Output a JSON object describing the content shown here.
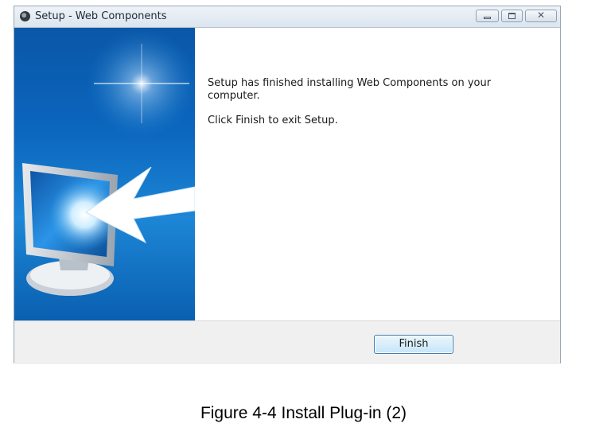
{
  "window": {
    "title": "Setup - Web Components",
    "app_icon": "setup-disc-icon",
    "controls": {
      "minimize_icon": "minimize-icon",
      "maximize_icon": "maximize-icon",
      "close_glyph": "✕"
    }
  },
  "side_panel": {
    "illustration": "monitor-with-arrow-illustration",
    "colors": {
      "background": "#0b66bd",
      "highlight": "#ffffff"
    }
  },
  "content": {
    "message": "Setup has finished installing Web Components on your computer.",
    "instruction": "Click Finish to exit Setup."
  },
  "footer": {
    "finish_label": "Finish"
  },
  "caption": "Figure 4-4 Install Plug-in (2)"
}
